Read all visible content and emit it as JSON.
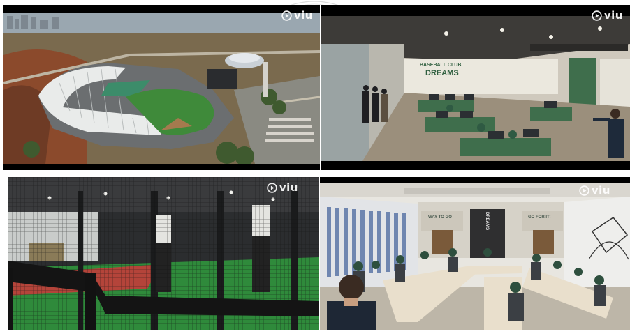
{
  "watermark": "seal",
  "panels": [
    {
      "id": "stadium-aerial",
      "logo": "viu"
    },
    {
      "id": "office-room",
      "logo": "viu",
      "sign_line1": "BASEBALL CLUB",
      "sign_line2": "DREAMS"
    },
    {
      "id": "batting-cages",
      "logo": "viu"
    },
    {
      "id": "meeting-room",
      "logo": "viu",
      "wall_left": "WAY TO GO",
      "wall_right": "GO FOR IT!",
      "door_text": "DREAMS"
    }
  ],
  "icons": {
    "logo": "play-circle-icon"
  },
  "colors": {
    "letterbox": "#000000",
    "field_green": "#2e7d32",
    "cubicle_green": "#3f6e4c"
  }
}
